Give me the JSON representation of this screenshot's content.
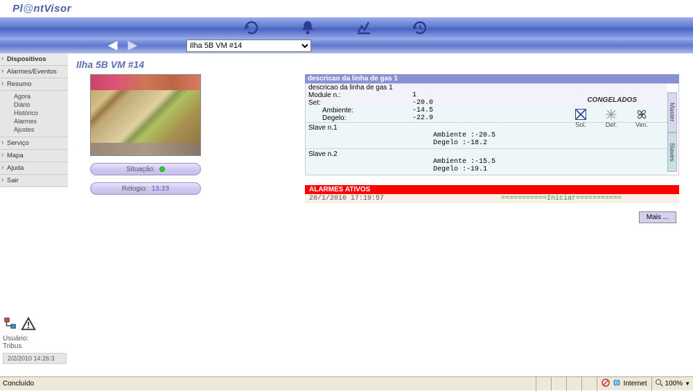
{
  "logo": {
    "pre": "Pl",
    "at": "@",
    "post": "ntVisor"
  },
  "device_select": "Ilha 5B VM #14",
  "sidebar": {
    "items": [
      "Dispositivos",
      "Alarmes/Eventos",
      "Resumo",
      "Serviço",
      "Mapa",
      "Ajuda",
      "Sair"
    ],
    "sub": [
      "Agora",
      "Diário",
      "Histórico",
      "Alarmes",
      "Ajustes"
    ]
  },
  "user": {
    "label": "Usuário:",
    "name": "Tribus",
    "timestamp": "2/2/2010 14:26:3"
  },
  "page_title": "Ilha 5B VM #14",
  "situation": {
    "label": "Situação:"
  },
  "clock": {
    "label": "Relogio:",
    "value": "13:23"
  },
  "panel": {
    "header": "descricao da linha de gas 1",
    "line1_label": "descricao da linha de gas 1",
    "module_label": "Module n.:",
    "module_val": "1",
    "congelados": "CONGELADOS",
    "set_label": "Set:",
    "set_val": "-20.0",
    "amb_label": "Ambiente:",
    "amb_val": "-14.5",
    "deg_label": "Degelo:",
    "deg_val": "-22.9",
    "icons": {
      "sol": "Sol.",
      "def": "Def.",
      "ven": "Ven."
    },
    "tabs": {
      "master": "Master",
      "slaves": "Slaves"
    },
    "slaves": [
      {
        "title": "Slave n.1",
        "amb": "Ambiente :-20.5",
        "deg": "Degelo :-18.2"
      },
      {
        "title": "Slave n.2",
        "amb": "Ambiente :-15.5",
        "deg": "Degelo :-19.1"
      }
    ]
  },
  "alarms": {
    "header": "ALARMES ATIVOS",
    "date": "28/1/2010 17:19:57",
    "msg": "===========Iniciar==========="
  },
  "more_btn": "Mais ...",
  "statusbar": {
    "left": "Concluído",
    "zone": "Internet",
    "zoom": "100%"
  }
}
